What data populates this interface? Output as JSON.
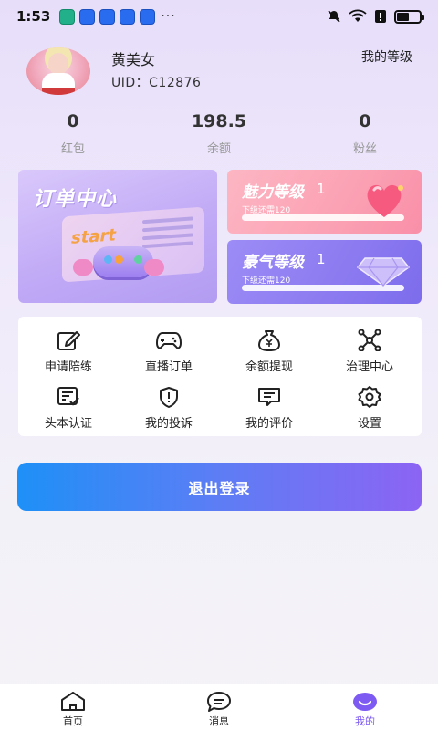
{
  "status_bar": {
    "time": "1:53",
    "dots": "···",
    "battery_level": 0.55
  },
  "profile": {
    "username": "黄美女",
    "uid": "UID：C12876",
    "level_link": "我的等级"
  },
  "stats": [
    {
      "value": "0",
      "label": "红包"
    },
    {
      "value": "198.5",
      "label": "余额"
    },
    {
      "value": "0",
      "label": "粉丝"
    }
  ],
  "order_card": {
    "title": "订单中心",
    "start_text": "start"
  },
  "levels": {
    "charm": {
      "title": "魅力等级",
      "level": "1",
      "next": "下级还需120",
      "progress": 0.0
    },
    "wealth": {
      "title": "豪气等级",
      "level": "1",
      "next": "下级还需120",
      "progress": 0.0
    }
  },
  "functions": [
    {
      "label": "申请陪练",
      "icon": "edit-icon"
    },
    {
      "label": "直播订单",
      "icon": "gamepad-icon"
    },
    {
      "label": "余额提现",
      "icon": "money-bag-icon"
    },
    {
      "label": "治理中心",
      "icon": "network-icon"
    },
    {
      "label": "头本认证",
      "icon": "certificate-icon"
    },
    {
      "label": "我的投诉",
      "icon": "complaint-icon"
    },
    {
      "label": "我的评价",
      "icon": "comment-icon"
    },
    {
      "label": "设置",
      "icon": "gear-icon"
    }
  ],
  "logout_label": "退出登录",
  "nav": [
    {
      "label": "首页",
      "icon": "home-icon"
    },
    {
      "label": "消息",
      "icon": "message-icon"
    },
    {
      "label": "我的",
      "icon": "profile-icon"
    }
  ],
  "accent_color": "#7d5bf2"
}
